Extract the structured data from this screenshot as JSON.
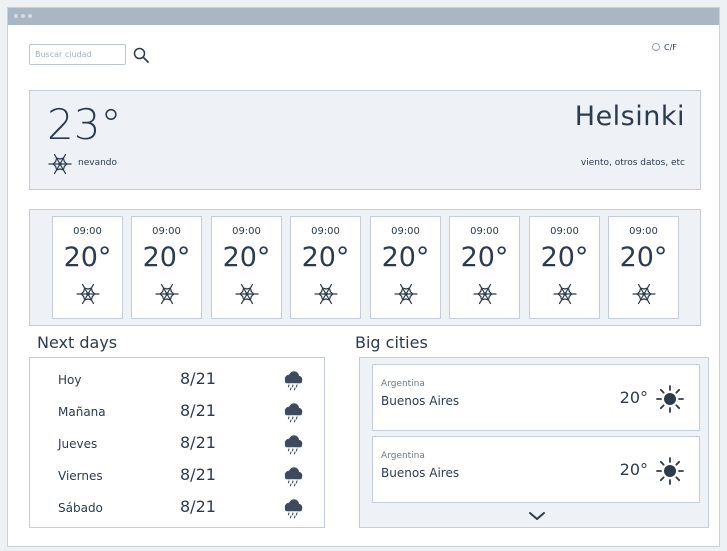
{
  "search": {
    "placeholder": "Buscar ciudad",
    "value": ""
  },
  "unit_toggle": {
    "label": "C/F"
  },
  "current": {
    "temperature": "23°",
    "condition": "nevando",
    "condition_icon": "snowflake-icon",
    "city": "Helsinki",
    "extra": "viento, otros datos, etc"
  },
  "hourly": [
    {
      "time": "09:00",
      "temp": "20°",
      "icon": "snowflake-icon"
    },
    {
      "time": "09:00",
      "temp": "20°",
      "icon": "snowflake-icon"
    },
    {
      "time": "09:00",
      "temp": "20°",
      "icon": "snowflake-icon"
    },
    {
      "time": "09:00",
      "temp": "20°",
      "icon": "snowflake-icon"
    },
    {
      "time": "09:00",
      "temp": "20°",
      "icon": "snowflake-icon"
    },
    {
      "time": "09:00",
      "temp": "20°",
      "icon": "snowflake-icon"
    },
    {
      "time": "09:00",
      "temp": "20°",
      "icon": "snowflake-icon"
    },
    {
      "time": "09:00",
      "temp": "20°",
      "icon": "snowflake-icon"
    }
  ],
  "next_days": {
    "title": "Next days",
    "days": [
      {
        "name": "Hoy",
        "date": "8/21",
        "icon": "rain-cloud-icon"
      },
      {
        "name": "Mañana",
        "date": "8/21",
        "icon": "rain-cloud-icon"
      },
      {
        "name": "Jueves",
        "date": "8/21",
        "icon": "rain-cloud-icon"
      },
      {
        "name": "Viernes",
        "date": "8/21",
        "icon": "rain-cloud-icon"
      },
      {
        "name": "Sábado",
        "date": "8/21",
        "icon": "rain-cloud-icon"
      }
    ]
  },
  "big_cities": {
    "title": "Big cities",
    "cities": [
      {
        "country": "Argentina",
        "city": "Buenos Aires",
        "temp": "20°",
        "icon": "sun-icon"
      },
      {
        "country": "Argentina",
        "city": "Buenos Aires",
        "temp": "20°",
        "icon": "sun-icon"
      }
    ],
    "more_icon": "chevron-down-icon"
  },
  "colors": {
    "text": "#2c3b4d",
    "panel": "#eef2f6",
    "border": "#c5ced8",
    "titlebar": "#a9b6c4"
  }
}
